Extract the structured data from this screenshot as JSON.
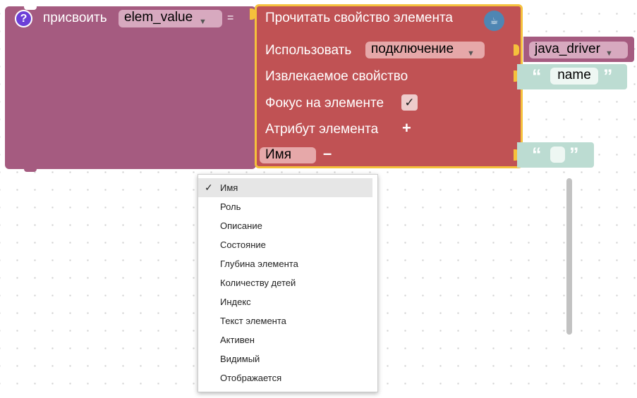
{
  "assign": {
    "help_glyph": "?",
    "label": "присвоить",
    "variable": "elem_value",
    "equals": "="
  },
  "read": {
    "title": "Прочитать свойство элемента",
    "use_label": "Использовать",
    "connection_value": "подключение",
    "property_label": "Извлекаемое свойство",
    "focus_label": "Фокус на элементе",
    "focus_checked": true,
    "focus_check_glyph": "✓",
    "attribute_label": "Атрибут элемента",
    "add_glyph": "+",
    "attr_value": "Имя",
    "remove_glyph": "–",
    "icon": "java-coffee-icon"
  },
  "driver": {
    "value": "java_driver"
  },
  "property_string": {
    "value": "name"
  },
  "attr_string": {
    "value": ""
  },
  "menu": {
    "selected_index": 0,
    "check_glyph": "✓",
    "items": [
      "Имя",
      "Роль",
      "Описание",
      "Состояние",
      "Глубина элемента",
      "Количеству детей",
      "Индекс",
      "Текст элемента",
      "Активен",
      "Видимый",
      "Отображается"
    ]
  },
  "colors": {
    "assign_block": "#a55b80",
    "read_block": "#c05254",
    "highlight": "#f5c13c",
    "string_block": "#bcdcd2",
    "help_icon": "#6c3fd8"
  }
}
